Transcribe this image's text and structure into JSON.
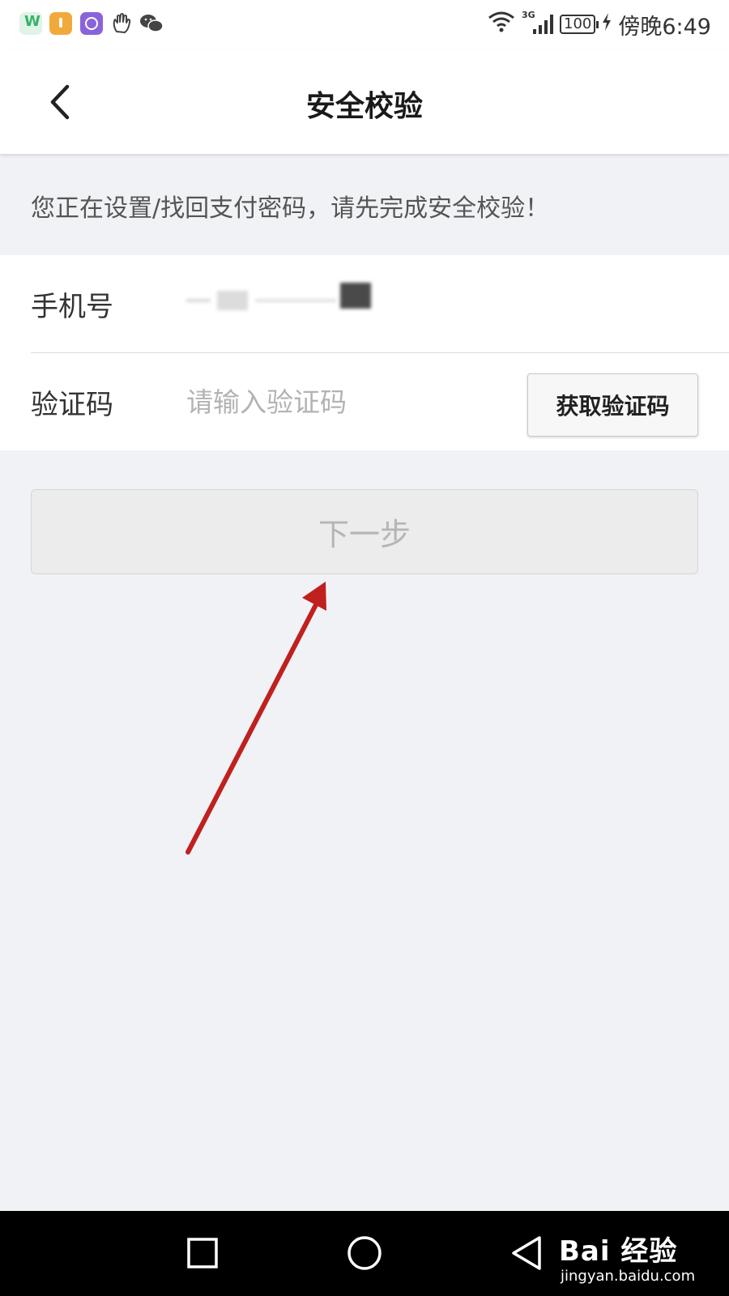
{
  "status_bar": {
    "time": "傍晚6:49",
    "network": "3G",
    "battery": "100",
    "app_icons": [
      "wps-icon",
      "app-orange-icon",
      "app-purple-icon",
      "hand-icon",
      "wechat-icon"
    ]
  },
  "header": {
    "title": "安全校验",
    "back_icon": "chevron-left-icon"
  },
  "notice": {
    "text": "您正在设置/找回支付密码，请先完成安全校验！"
  },
  "form": {
    "phone": {
      "label": "手机号"
    },
    "code": {
      "label": "验证码",
      "placeholder": "请输入验证码",
      "value": "",
      "get_code_label": "获取验证码"
    }
  },
  "next_button": {
    "label": "下一步",
    "enabled": false
  },
  "annotation": {
    "type": "arrow",
    "color": "#c0201e"
  },
  "nav_bar": {
    "buttons": [
      "recent-apps-icon",
      "home-icon",
      "back-icon"
    ]
  },
  "watermark": {
    "main": "Bai 经验",
    "sub": "jingyan.baidu.com"
  },
  "colors": {
    "page_bg": "#f1f2f6",
    "nav_bg": "#000000",
    "placeholder": "#b3b3b3",
    "disabled_text": "#b5b5b5"
  }
}
